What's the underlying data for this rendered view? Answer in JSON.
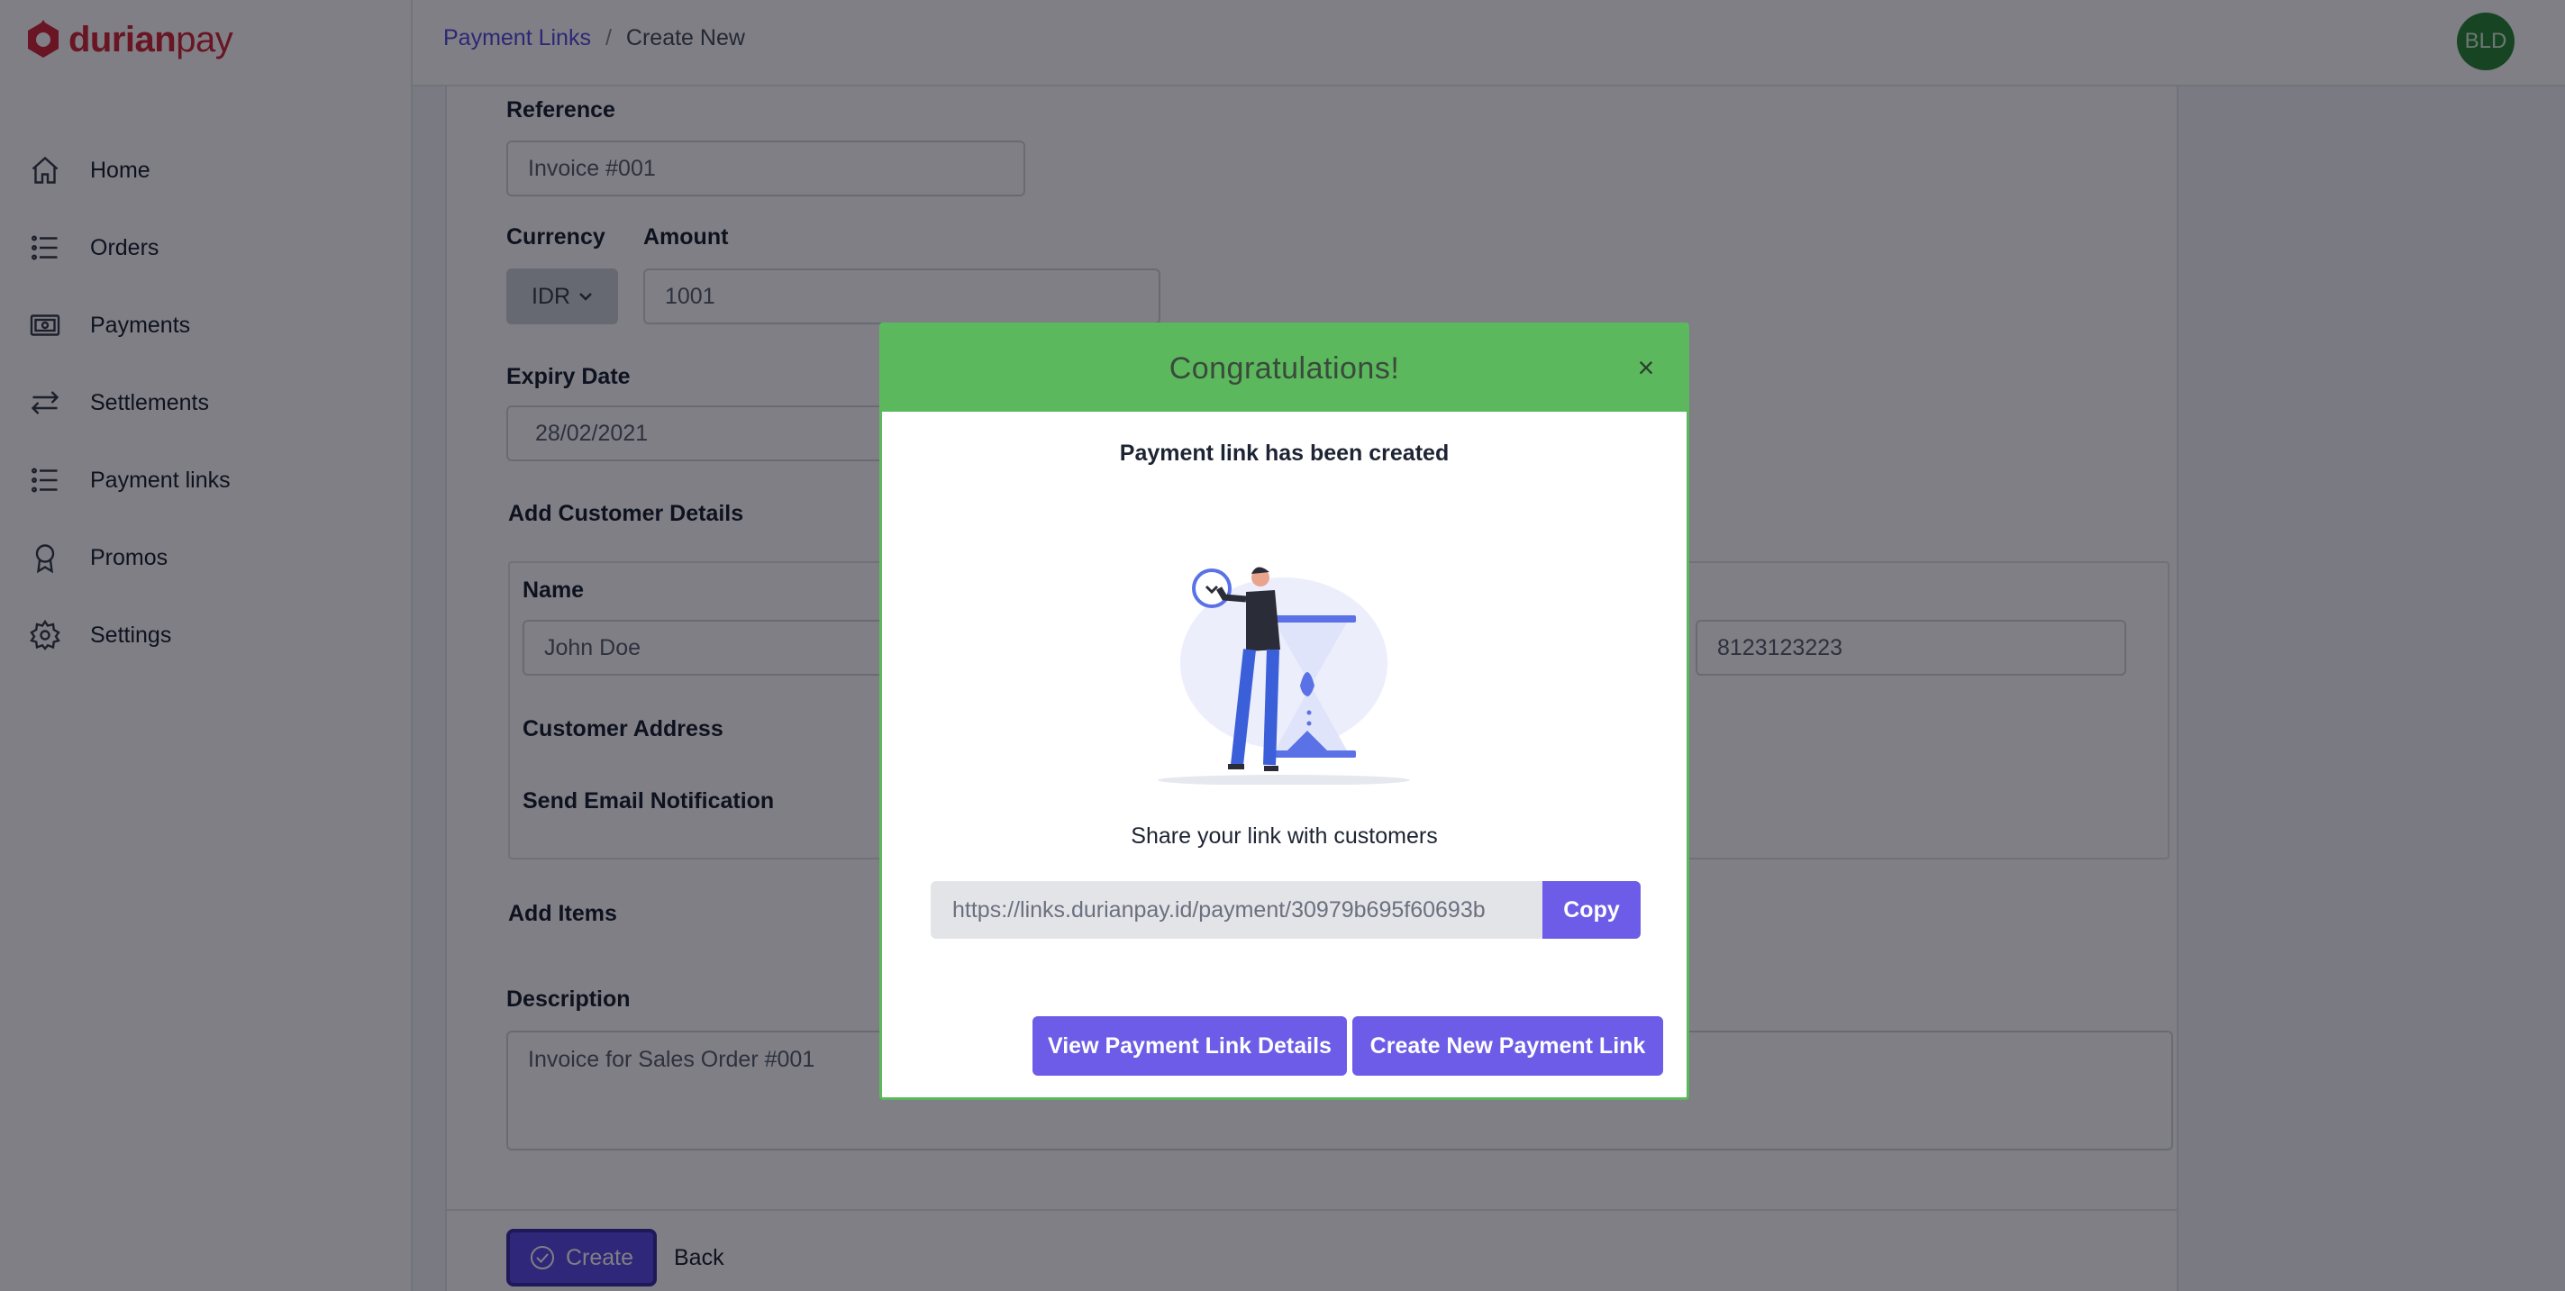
{
  "brand": {
    "logo_part1": "durian",
    "logo_part2": "pay",
    "color": "#d22a3c",
    "accent": "#6c5ce7",
    "success": "#5cb85c"
  },
  "sidebar": {
    "items": [
      {
        "label": "Home",
        "icon": "home-icon"
      },
      {
        "label": "Orders",
        "icon": "list-icon"
      },
      {
        "label": "Payments",
        "icon": "payments-icon"
      },
      {
        "label": "Settlements",
        "icon": "transfer-icon"
      },
      {
        "label": "Payment links",
        "icon": "list-icon"
      },
      {
        "label": "Promos",
        "icon": "badge-icon"
      },
      {
        "label": "Settings",
        "icon": "gear-icon"
      }
    ]
  },
  "header": {
    "breadcrumb": {
      "parent": "Payment Links",
      "separator": "/",
      "current": "Create New"
    },
    "avatar": "BLD"
  },
  "form": {
    "reference": {
      "label": "Reference",
      "placeholder": "Invoice #001"
    },
    "currency": {
      "label": "Currency",
      "value": "IDR"
    },
    "amount": {
      "label": "Amount",
      "placeholder": "1001"
    },
    "expiry": {
      "label": "Expiry Date",
      "value": "28/02/2021"
    },
    "customer_section": "Add Customer Details",
    "name": {
      "label": "Name",
      "placeholder": "John Doe"
    },
    "phone": {
      "placeholder": "8123123223"
    },
    "address_label": "Customer Address",
    "email_notification_label": "Send Email Notification",
    "items_label": "Add Items",
    "description": {
      "label": "Description",
      "placeholder": "Invoice for Sales Order #001"
    },
    "create_label": "Create",
    "back_label": "Back"
  },
  "modal": {
    "title": "Congratulations!",
    "close": "×",
    "subtitle": "Payment link has been created",
    "share_text": "Share your link with customers",
    "link": "https://links.durianpay.id/payment/30979b695f60693b",
    "copy_label": "Copy",
    "view_details_label": "View Payment Link Details",
    "create_new_label": "Create New Payment Link"
  }
}
